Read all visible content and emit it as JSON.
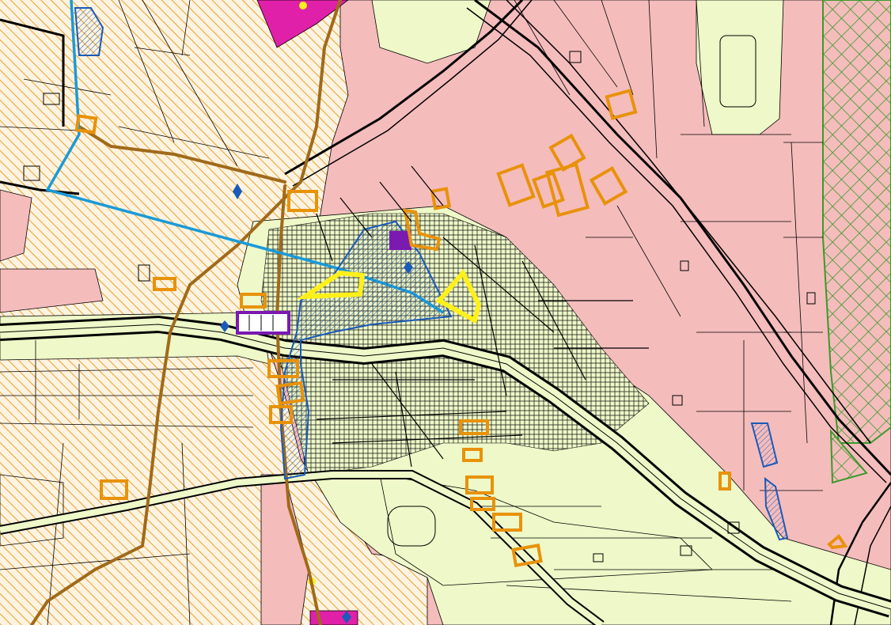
{
  "map": {
    "type": "zoning-plan",
    "labels": [],
    "colors": {
      "agricultural_hatch": "#e8a030",
      "residential": "#f5bcbc",
      "urban_green": "#eef8c8",
      "protected_crosshatch": "#3a9a2a",
      "cycle_route": "#1a9ad8",
      "heritage_zone": "#1a5ab8",
      "main_road": "#a06a1a",
      "special_use": "#e020a8",
      "civic": "#7a1ab0",
      "landmark": "#fff01a",
      "commercial_outline": "#e8920a",
      "road_line": "#000000"
    },
    "legend": {}
  }
}
